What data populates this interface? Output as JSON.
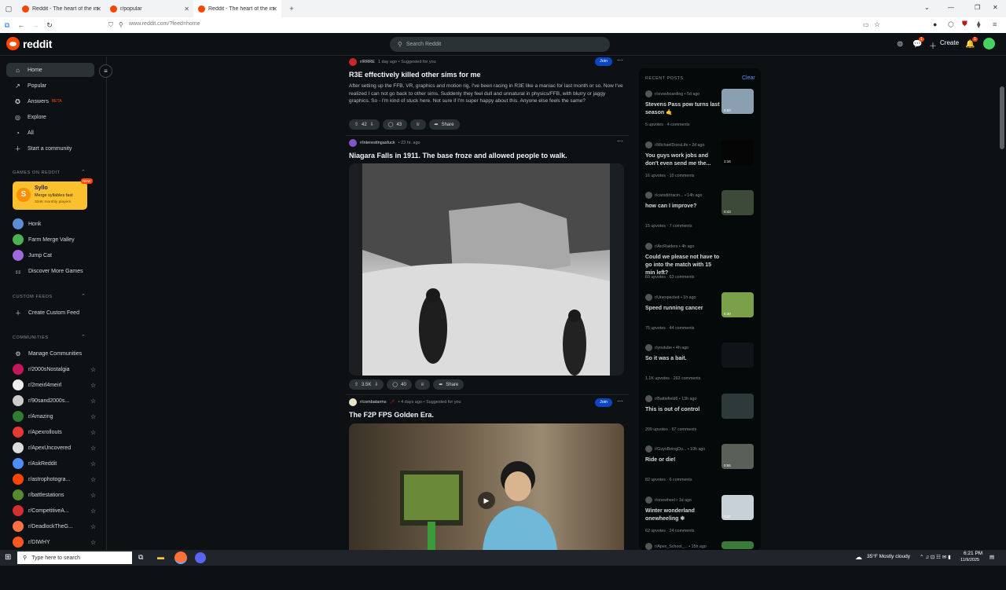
{
  "browser": {
    "tabs": [
      {
        "title": "Reddit - The heart of the intern",
        "active": false
      },
      {
        "title": "r/popular",
        "active": false
      },
      {
        "title": "Reddit - The heart of the intern",
        "active": true
      }
    ],
    "url": "www.reddit.com/?feed=home"
  },
  "header": {
    "logo": "reddit",
    "search_placeholder": "Search Reddit",
    "create_label": "Create",
    "chat_badge": "1",
    "notif_badge": "1"
  },
  "sidebar": {
    "nav": [
      {
        "label": "Home",
        "icon": "home-icon",
        "selected": true
      },
      {
        "label": "Popular",
        "icon": "popular-icon"
      },
      {
        "label": "Answers",
        "icon": "answers-icon",
        "badge": "BETA"
      },
      {
        "label": "Explore",
        "icon": "explore-icon"
      },
      {
        "label": "All",
        "icon": "all-icon"
      },
      {
        "label": "Start a community",
        "icon": "plus-icon"
      }
    ],
    "games_heading": "GAMES ON REDDIT",
    "featured_game": {
      "name": "Syllo",
      "tagline": "Merge syllables fast",
      "players": "334K monthly players",
      "badge": "NEW"
    },
    "games": [
      {
        "label": "Honk",
        "color": "#5b8dd6"
      },
      {
        "label": "Farm Merge Valley",
        "color": "#4caf50"
      },
      {
        "label": "Jump Cat",
        "color": "#9c6ade"
      },
      {
        "label": "Discover More Games",
        "color": "#000000"
      }
    ],
    "custom_heading": "CUSTOM FEEDS",
    "create_custom_feed": "Create Custom Feed",
    "communities_heading": "COMMUNITIES",
    "manage_communities": "Manage Communities",
    "communities": [
      {
        "name": "r/2000sNostalgia",
        "color": "#c2185b"
      },
      {
        "name": "r/2meirl4meirl",
        "color": "#eeeeee"
      },
      {
        "name": "r/90sand2000s...",
        "color": "#cccccc"
      },
      {
        "name": "r/Amazing",
        "color": "#2e7d32"
      },
      {
        "name": "r/Apexrollouts",
        "color": "#e53935"
      },
      {
        "name": "r/ApexUncovered",
        "color": "#dddddd"
      },
      {
        "name": "r/AskReddit",
        "color": "#4f8ef7"
      },
      {
        "name": "r/astrophotogra...",
        "color": "#ff4500"
      },
      {
        "name": "r/battlestations",
        "color": "#558b2f"
      },
      {
        "name": "r/CompetitiveA...",
        "color": "#d32f2f"
      },
      {
        "name": "r/DeadlockTheG...",
        "color": "#ff7043"
      },
      {
        "name": "r/DIWHY",
        "color": "#ff5722"
      }
    ]
  },
  "feed": {
    "posts": [
      {
        "subreddit": "r/RRRE",
        "meta": "1 day ago • Suggested for you",
        "join": "Join",
        "title": "R3E effectively killed other sims for me",
        "body": "After setting up the FFB, VR, graphics and motion rig, I've been racing in R3E like a maniac for last month or so. Now I've realized I can not go back to other sims. Suddenly they feel dull and unnatural in physics/FFB, with blurry or jaggy graphics. So - I'm kind of stuck here. Not sure if I'm super happy about this. Anyone else feels the same?",
        "votes": "42",
        "comments": "43",
        "share": "Share"
      },
      {
        "subreddit": "r/interestingasfuck",
        "meta": "• 23 hr. ago",
        "title": "Niagara Falls in 1911. The base froze and allowed people to walk.",
        "votes": "3.5K",
        "comments": "40",
        "share": "Share"
      },
      {
        "subreddit": "r/combatarms",
        "meta": "• 4 days ago • Suggested for you",
        "join": "Join",
        "title": "The F2P FPS Golden Era."
      }
    ]
  },
  "recent": {
    "heading": "RECENT POSTS",
    "clear": "Clear",
    "items": [
      {
        "sub": "r/snowboarding • 5d ago",
        "title": "Stevens Pass pow turns last season 🤙",
        "upvotes": "5 upvotes",
        "comments": "4 comments",
        "thumb": "#8aa0b0",
        "badge": "0:03"
      },
      {
        "sub": "r/MichaelDoesLife • 2d ago",
        "title": "You guys work jobs and don't even send me the...",
        "upvotes": "16 upvotes",
        "comments": "10 comments",
        "thumb": "#050505",
        "badge": "1:16"
      },
      {
        "sub": "r/carsdirtracin... • 14h ago",
        "title": "how can I improve?",
        "upvotes": "15 upvotes",
        "comments": "7 comments",
        "thumb": "#3d4a3a",
        "badge": "0:43"
      },
      {
        "sub": "r/ArcRaiders • 4h ago",
        "title": "Could we please not have to go into the match with 15 min left?",
        "upvotes": "60 upvotes",
        "comments": "63 comments",
        "thumb": "",
        "badge": ""
      },
      {
        "sub": "r/Unexpected • 1h ago",
        "title": "Speed running cancer",
        "upvotes": "75 upvotes",
        "comments": "44 comments",
        "thumb": "#7aa04a",
        "badge": "0:30"
      },
      {
        "sub": "r/youtube • 4h ago",
        "title": "So it was a bait.",
        "upvotes": "1.1K upvotes",
        "comments": "263 comments",
        "thumb": "#101418",
        "badge": ""
      },
      {
        "sub": "r/Battlefield6 • 13h ago",
        "title": "This is out of control",
        "upvotes": "209 upvotes",
        "comments": "67 comments",
        "thumb": "#2e3a3a",
        "badge": ""
      },
      {
        "sub": "r/GuysBeingDu... • 10h ago",
        "title": "Ride or die!",
        "upvotes": "82 upvotes",
        "comments": "6 comments",
        "thumb": "#5a6058",
        "badge": "0:55"
      },
      {
        "sub": "r/onewheel • 1d ago",
        "title": "Winter wonderland onewheeling ❄",
        "upvotes": "62 upvotes",
        "comments": "24 comments",
        "thumb": "#c8d0d8",
        "badge": "0:20"
      },
      {
        "sub": "r/Apex_School_... • 15h ago",
        "title": "",
        "upvotes": "",
        "comments": "",
        "thumb": "#3a7a3a",
        "badge": ""
      }
    ]
  },
  "taskbar": {
    "search_placeholder": "Type here to search",
    "weather": "35°F  Mostly cloudy",
    "time": "6:21 PM",
    "date": "11/9/2025"
  }
}
